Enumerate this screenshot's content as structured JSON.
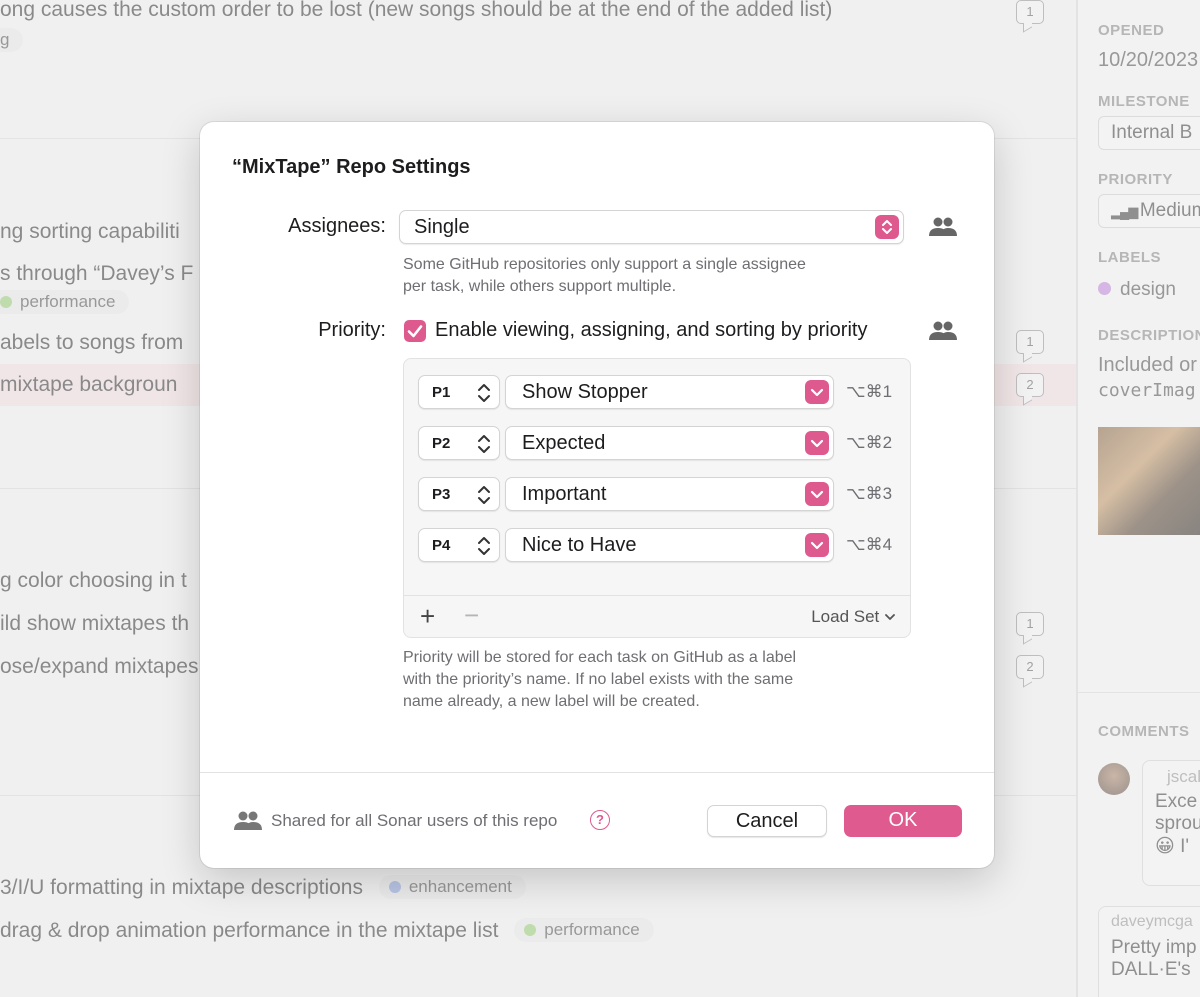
{
  "background": {
    "rows": [
      {
        "text": "ong causes the custom order to be lost (new songs should be at the end of the added list)",
        "comments": "1"
      },
      {
        "text": "g"
      },
      {
        "text": "ng sorting capabiliti"
      },
      {
        "text": "s through “Davey’s F",
        "label": "performance",
        "label_color": "#9ccf7a"
      },
      {
        "text": "abels to songs from",
        "comments": "1"
      },
      {
        "text": " mixtape backgroun",
        "comments": "2"
      },
      {
        "text": "g color choosing in t"
      },
      {
        "text": "ild show mixtapes th",
        "comments": "1"
      },
      {
        "text": "ose/expand mixtapes",
        "comments": "2"
      },
      {
        "text": "3/I/U formatting in mixtape descriptions",
        "label": "enhancement",
        "label_color": "#8ea6e0"
      },
      {
        "text": " drag & drop animation performance in the mixtape list",
        "label": "performance",
        "label_color": "#9ccf7a"
      }
    ],
    "sidebar": {
      "opened_heading": "OPENED",
      "opened_value": "10/20/2023",
      "milestone_heading": "MILESTONE",
      "milestone_value": "Internal B",
      "priority_heading": "PRIORITY",
      "priority_value": "Medium",
      "labels_heading": "LABELS",
      "label_value": "design",
      "description_heading": "DESCRIPTION",
      "description_line1": "Included or",
      "description_line2": "coverImag",
      "comments_heading": "COMMENTS",
      "comment1_author": "jscalc",
      "comment1_line1": "Exce",
      "comment1_line2": "sprou",
      "comment1_line3": "😀 I'",
      "comment2_author": "daveymcga",
      "comment2_line1": "Pretty imp",
      "comment2_line2": "DALL·E's"
    }
  },
  "modal": {
    "title": "“MixTape” Repo Settings",
    "assignees_label": "Assignees:",
    "assignees_value": "Single",
    "assignees_help_1": "Some GitHub repositories only support a single assignee",
    "assignees_help_2": "per task, while others support multiple.",
    "priority_label": "Priority:",
    "priority_checkbox_label": "Enable viewing, assigning, and sorting by priority",
    "priority_enabled": true,
    "priorities": [
      {
        "code": "P1",
        "name": "Show Stopper",
        "shortcut": "⌥⌘1"
      },
      {
        "code": "P2",
        "name": "Expected",
        "shortcut": "⌥⌘2"
      },
      {
        "code": "P3",
        "name": "Important",
        "shortcut": "⌥⌘3"
      },
      {
        "code": "P4",
        "name": "Nice to Have",
        "shortcut": "⌥⌘4"
      }
    ],
    "add_symbol": "+",
    "remove_symbol": "−",
    "load_set_label": "Load Set",
    "priority_help_1": "Priority will be stored for each task on GitHub as a label",
    "priority_help_2": "with the priority’s name. If no label exists with the same",
    "priority_help_3": "name already, a new label will be created.",
    "footer_text": "Shared for all Sonar users of this repo",
    "help_symbol": "?",
    "cancel_label": "Cancel",
    "ok_label": "OK"
  },
  "colors": {
    "accent": "#de5a8e"
  }
}
